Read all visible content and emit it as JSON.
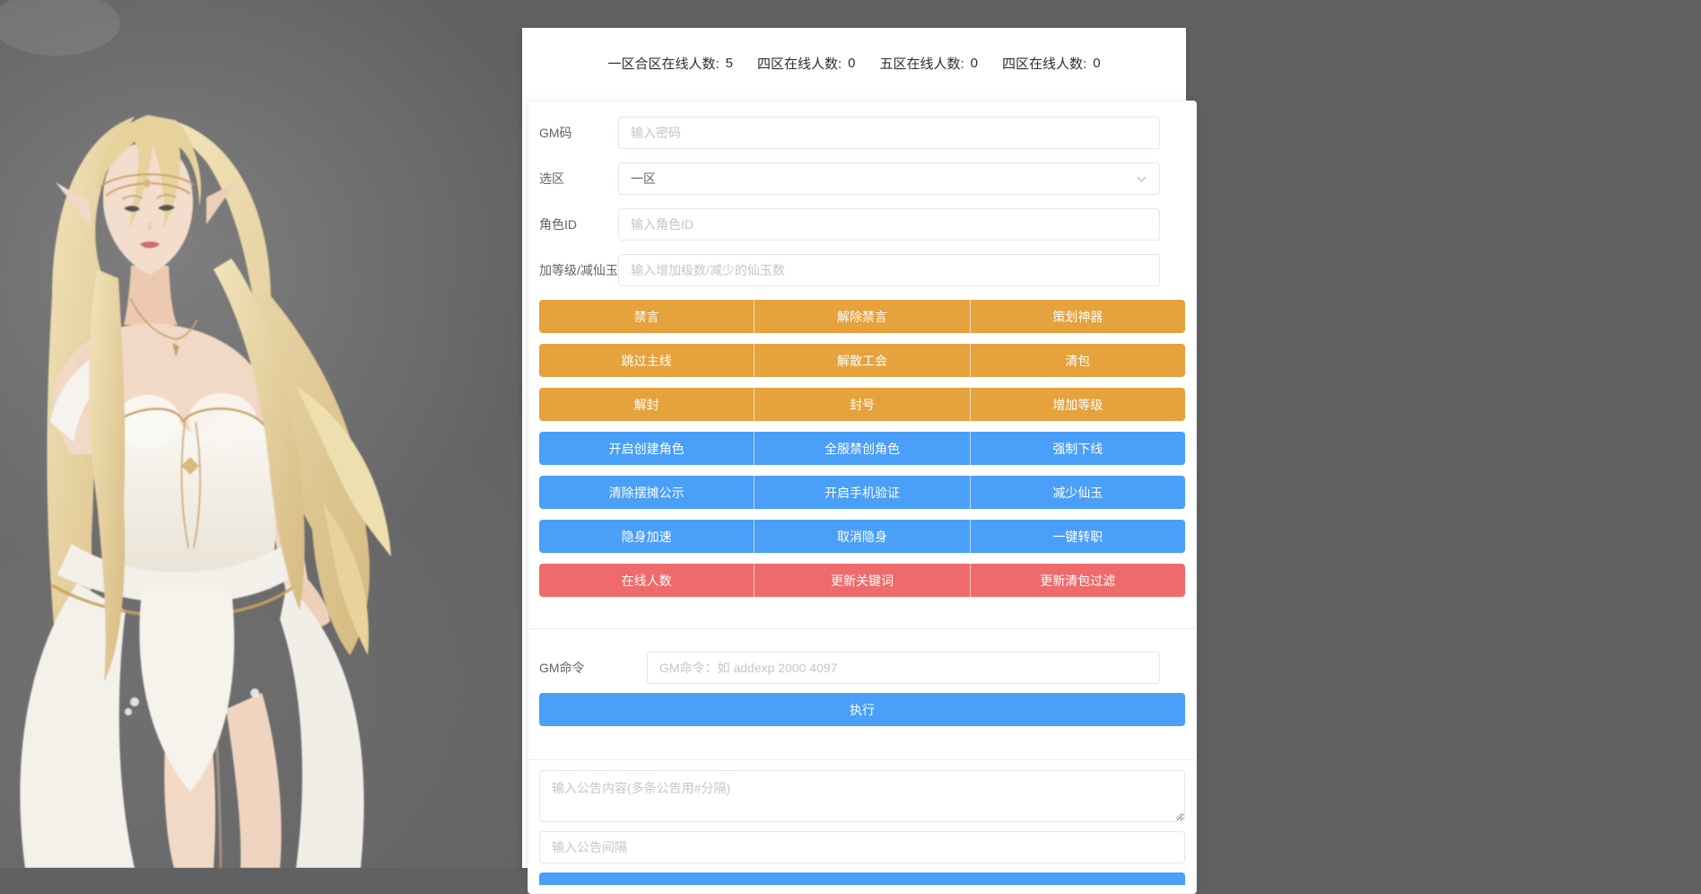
{
  "colors": {
    "page_background": "#616161",
    "warning_button": "#e6a23c",
    "primary_button": "#4a9ff8",
    "danger_button": "#ef6b6b",
    "panel": "#ffffff"
  },
  "stats_bar": {
    "items": [
      {
        "label": "一区合区在线人数:",
        "value": "5"
      },
      {
        "label": "四区在线人数:",
        "value": "0"
      },
      {
        "label": "五区在线人数:",
        "value": "0"
      },
      {
        "label": "四区在线人数:",
        "value": "0"
      }
    ]
  },
  "form": {
    "gm_code": {
      "label": "GM码",
      "placeholder": "输入密码",
      "value": ""
    },
    "zone": {
      "label": "选区",
      "value": "一区",
      "icon": "chevron-down-icon"
    },
    "role_id": {
      "label": "角色ID",
      "placeholder": "输入角色ID",
      "value": ""
    },
    "level_jade": {
      "label": "加等级/减仙玉",
      "placeholder": "输入增加级数/减少的仙玉数",
      "value": ""
    }
  },
  "button_groups": [
    {
      "style": "warning",
      "buttons": [
        "禁言",
        "解除禁言",
        "策划神器"
      ]
    },
    {
      "style": "warning",
      "buttons": [
        "跳过主线",
        "解散工会",
        "清包"
      ]
    },
    {
      "style": "warning",
      "buttons": [
        "解封",
        "封号",
        "增加等级"
      ]
    },
    {
      "style": "primary",
      "buttons": [
        "开启创建角色",
        "全服禁创角色",
        "强制下线"
      ]
    },
    {
      "style": "primary",
      "buttons": [
        "清除摆摊公示",
        "开启手机验证",
        "减少仙玉"
      ]
    },
    {
      "style": "primary",
      "buttons": [
        "隐身加速",
        "取消隐身",
        "一键转职"
      ]
    },
    {
      "style": "danger",
      "buttons": [
        "在线人数",
        "更新关键词",
        "更新清包过滤"
      ]
    }
  ],
  "gm_command": {
    "label": "GM命令",
    "placeholder": "GM命令：如 addexp 2000 4097",
    "value": "",
    "execute_label": "执行"
  },
  "announcement": {
    "content_placeholder": "输入公告内容(多条公告用#分隔)",
    "content_value": "",
    "interval_placeholder": "输入公告间隔",
    "interval_value": ""
  }
}
